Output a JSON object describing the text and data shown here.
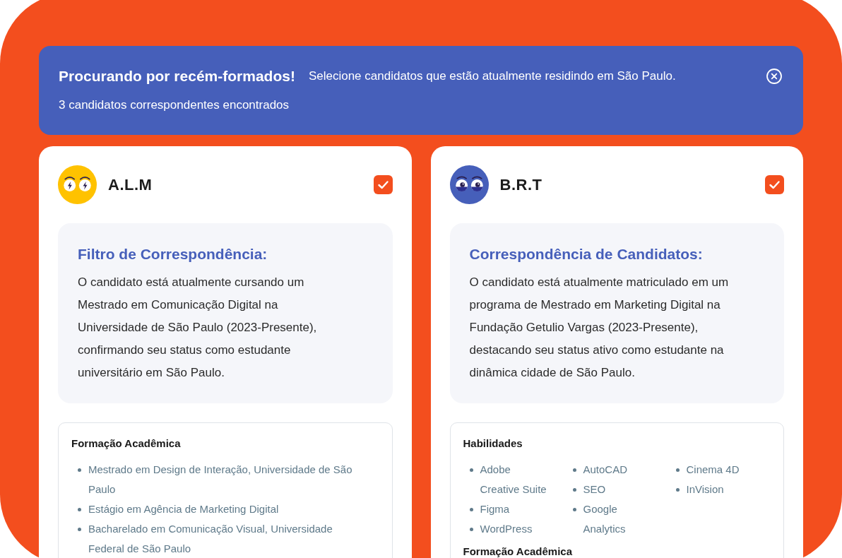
{
  "banner": {
    "title": "Procurando por recém-formados!",
    "message": "Selecione candidatos que estão atualmente residindo em São Paulo.",
    "count_text": "3 candidatos correspondentes encontrados"
  },
  "candidates": [
    {
      "name": "A.L.M",
      "avatar": {
        "kind": "bolt-eyes",
        "color": "#ffc200"
      },
      "checked": true,
      "match": {
        "title": "Filtro de Correspondência:",
        "text": "O candidato está atualmente cursando um Mestrado em Comunicação Digital na Universidade de São Paulo (2023-Presente), confirmando seu status como estudante universitário em São Paulo."
      },
      "sections": [
        {
          "kind": "list",
          "heading": "Formação Acadêmica",
          "items": [
            "Mestrado em Design de Interação, Universidade de São Paulo",
            "Estágio em Agência de Marketing Digital",
            "Bacharelado em Comunicação Visual, Universidade Federal de São Paulo"
          ]
        }
      ]
    },
    {
      "name": "B.R.T",
      "avatar": {
        "kind": "round-eyes",
        "color": "#465fba"
      },
      "checked": true,
      "match": {
        "title": "Correspondência de Candidatos:",
        "text": "O candidato está atualmente matriculado em um programa de Mestrado em Marketing Digital na Fundação Getulio Vargas (2023-Presente), destacando seu status ativo como estudante na dinâmica cidade de São Paulo."
      },
      "sections": [
        {
          "kind": "columns",
          "heading": "Habilidades",
          "columns": [
            {
              "items": [
                "Adobe Creative Suite",
                "Figma",
                "WordPress"
              ]
            },
            {
              "items": [
                "AutoCAD",
                "SEO",
                "Google Analytics"
              ]
            },
            {
              "items": [
                "Cinema 4D",
                "InVision"
              ]
            }
          ]
        },
        {
          "kind": "list",
          "heading": "Formação Acadêmica"
        }
      ]
    }
  ]
}
